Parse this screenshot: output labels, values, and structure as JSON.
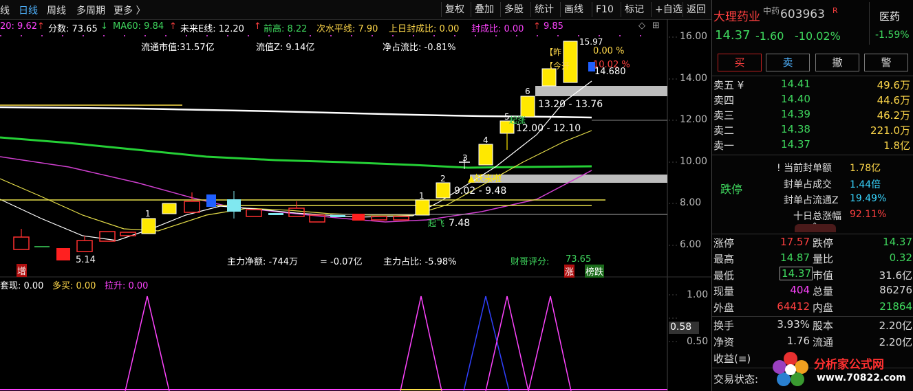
{
  "toolbar": {
    "tabs": [
      "线",
      "日线",
      "周线",
      "多周期",
      "更多 〉"
    ],
    "buttons": [
      "复权",
      "叠加",
      "多股",
      "统计",
      "画线",
      "F10",
      "标记",
      "+自选",
      "返回"
    ]
  },
  "indicators": {
    "ma20": "20: 9.62",
    "arrow_up": "↑",
    "fenshu": "分数: 73.65",
    "arrow_down": "↓",
    "ma60": "MA60: 9.84",
    "weilai": "未来E线: 12.20",
    "qiangao": "前高: 8.22",
    "cishuiping": "次水平线: 7.90",
    "fengchengbi": "上日封成比: 0.00",
    "fengchengbi2": "封成比: 0.00",
    "v985": "9.85"
  },
  "main_chart": {
    "liutong": "流通市值:31.57亿",
    "liuzhi": "流值Z: 9.14亿",
    "jingzhan": "净占流比: -0.81%",
    "price_high": "15.97",
    "zuo": "【昨",
    "zuo_val": "0.00 %",
    "jin": "【今开",
    "jin_val": "10.02 %",
    "p4680": "14.680",
    "box1": "13.20 - 13.76",
    "box2": "12.00 - 12.10",
    "box3": "9.02 - 9.48",
    "qizhang": "起涨",
    "yaolaila": "▲妖来啦",
    "qifei": "起飞",
    "p748": "7.48",
    "p514": "5.14",
    "zhuli": "主力净额: -744万",
    "zhuli2": "= -0.07亿",
    "zhanbi": "主力占比: -5.98%",
    "caifu": "财哥评分:",
    "caifu_val": "73.65",
    "zeng": "增",
    "zhang": "涨",
    "bangdie": "榜跌",
    "count_labels": [
      "1",
      "1",
      "2",
      "3",
      "4",
      "5",
      "6"
    ],
    "y_labels": [
      "16.00",
      "14.00",
      "12.00",
      "10.00",
      "8.00",
      "6.00"
    ]
  },
  "sub_chart": {
    "taoxian": "套现: 0.00",
    "duomai": "多买: 0.00",
    "lasheng": "拉升: 0.00",
    "y_labels": [
      "1.00",
      "0.50"
    ],
    "current": "0.58"
  },
  "panel": {
    "name": "大理药业",
    "sector_tag": "中药",
    "code": "603963",
    "r": "R",
    "industry": "医药",
    "industry_pct": "-1.59%",
    "price": "14.37",
    "change": "-1.60",
    "change_pct": "-10.02%",
    "actions": [
      "买",
      "卖",
      "撤",
      "警"
    ],
    "asks": [
      {
        "label": "卖五 ¥",
        "price": "14.41",
        "vol": "49.6万"
      },
      {
        "label": "卖四",
        "price": "14.40",
        "vol": "44.6万"
      },
      {
        "label": "卖三",
        "price": "14.39",
        "vol": "46.2万"
      },
      {
        "label": "卖二",
        "price": "14.38",
        "vol": "221.0万"
      },
      {
        "label": "卖一",
        "price": "14.37",
        "vol": "1.8亿"
      }
    ],
    "dieting": "跌停",
    "limit_info": [
      {
        "label": "! 当前封单额",
        "value": "1.78亿"
      },
      {
        "label": "封单占成交",
        "value": "1.44倍"
      },
      {
        "label": "封单占流通Z",
        "value": "19.49%"
      },
      {
        "label": "十日总涨幅",
        "value": "92.11%"
      }
    ],
    "stats": [
      {
        "l1": "涨停",
        "v1": "17.57",
        "l2": "跌停",
        "v2": "14.37"
      },
      {
        "l1": "最高",
        "v1": "14.87",
        "l2": "量比",
        "v2": "0.32"
      },
      {
        "l1": "最低",
        "v1": "14.37",
        "l2": "市值",
        "v2": "31.6亿"
      },
      {
        "l1": "现量",
        "v1": "404",
        "l2": "总量",
        "v2": "86276"
      },
      {
        "l1": "外盘",
        "v1": "64412",
        "l2": "内盘",
        "v2": "21864"
      }
    ],
    "stats2": [
      {
        "l1": "换手",
        "v1": "3.93%",
        "l2": "股本",
        "v2": "2.20亿"
      },
      {
        "l1": "净资",
        "v1": "1.76",
        "l2": "流通",
        "v2": "2.20亿"
      }
    ],
    "shouyi": "收益(≡)",
    "jiaoyi": "交易状态:",
    "logo_text": "分析家公式网",
    "logo_url": "www.70822.com"
  }
}
